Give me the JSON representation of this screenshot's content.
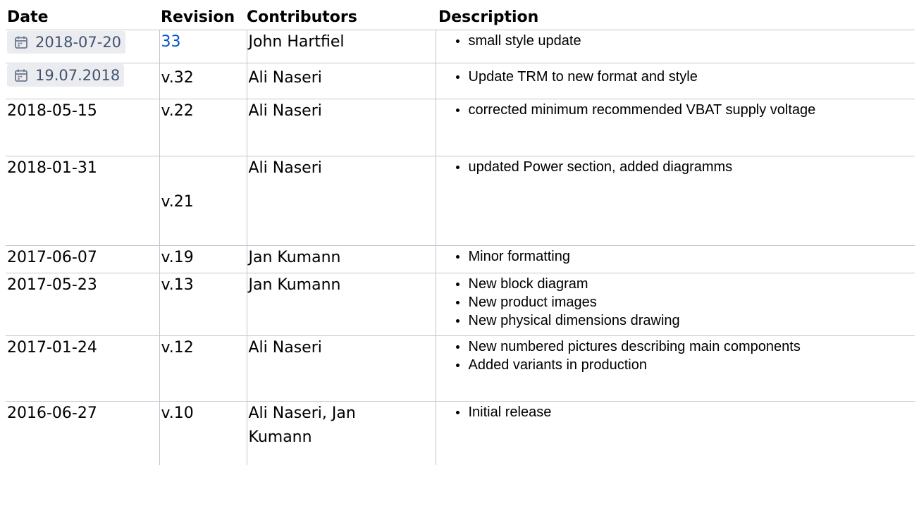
{
  "headers": {
    "date": "Date",
    "revision": "Revision",
    "contributors": "Contributors",
    "description": "Description"
  },
  "rows": [
    {
      "date": "2018-07-20",
      "date_style": "chip",
      "revision": "33",
      "revision_style": "link",
      "contributors": "John Hartfiel",
      "items": [
        "small style update"
      ]
    },
    {
      "date": "19.07.2018",
      "date_style": "chip",
      "revision": "v.32",
      "contributors": "Ali Naseri",
      "items": [
        "Update TRM to new format and style"
      ]
    },
    {
      "date": "2018-05-15",
      "revision": "v.22",
      "contributors": "Ali Naseri",
      "items": [
        "corrected minimum recommended VBAT supply voltage"
      ]
    },
    {
      "date": "2018-01-31",
      "revision": "v.21",
      "contributors": "Ali Naseri",
      "items": [
        "updated Power section, added diagramms"
      ]
    },
    {
      "date": "2017-06-07",
      "revision": "v.19",
      "contributors": "Jan Kumann",
      "items": [
        "Minor formatting"
      ]
    },
    {
      "date": "2017-05-23",
      "revision": "v.13",
      "contributors": "Jan Kumann",
      "items": [
        "New block diagram",
        "New product images",
        "New physical dimensions drawing"
      ]
    },
    {
      "date": "2017-01-24",
      "revision": "v.12",
      "contributors": "Ali Naseri",
      "items": [
        "New numbered pictures describing main components",
        "Added variants in production"
      ]
    },
    {
      "date": "2016-06-27",
      "revision": "v.10",
      "contributors": "Ali Naseri, Jan Kumann",
      "items": [
        "Initial release"
      ]
    }
  ],
  "icons": {
    "date_chip": "calendar-icon"
  },
  "colors": {
    "link": "#0052cc",
    "chip_bg": "#ebecf0",
    "chip_text": "#42526e",
    "border": "#c1c7d0"
  }
}
